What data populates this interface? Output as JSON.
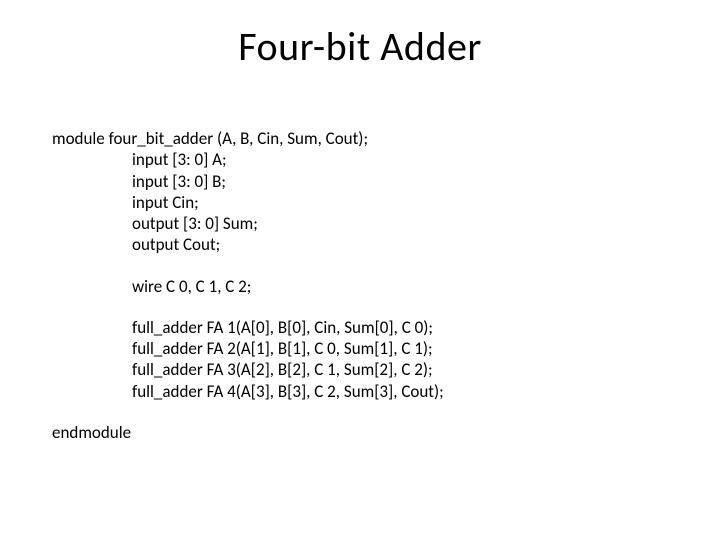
{
  "title": "Four-bit Adder",
  "code": {
    "module_decl": "module four_bit_adder (A, B, Cin, Sum, Cout);",
    "decl_inputA": "input [3: 0] A;",
    "decl_inputB": "input [3: 0] B;",
    "decl_inputCin": "input Cin;",
    "decl_outputSum": "output [3: 0] Sum;",
    "decl_outputCout": "output Cout;",
    "wire_decl": "wire C 0, C 1, C 2;",
    "inst_fa1": "full_adder FA 1(A[0], B[0], Cin, Sum[0], C 0);",
    "inst_fa2": "full_adder FA 2(A[1], B[1], C 0, Sum[1], C 1);",
    "inst_fa3": "full_adder FA 3(A[2], B[2], C 1, Sum[2], C 2);",
    "inst_fa4": "full_adder FA 4(A[3], B[3], C 2, Sum[3], Cout);",
    "endmodule": "endmodule"
  }
}
